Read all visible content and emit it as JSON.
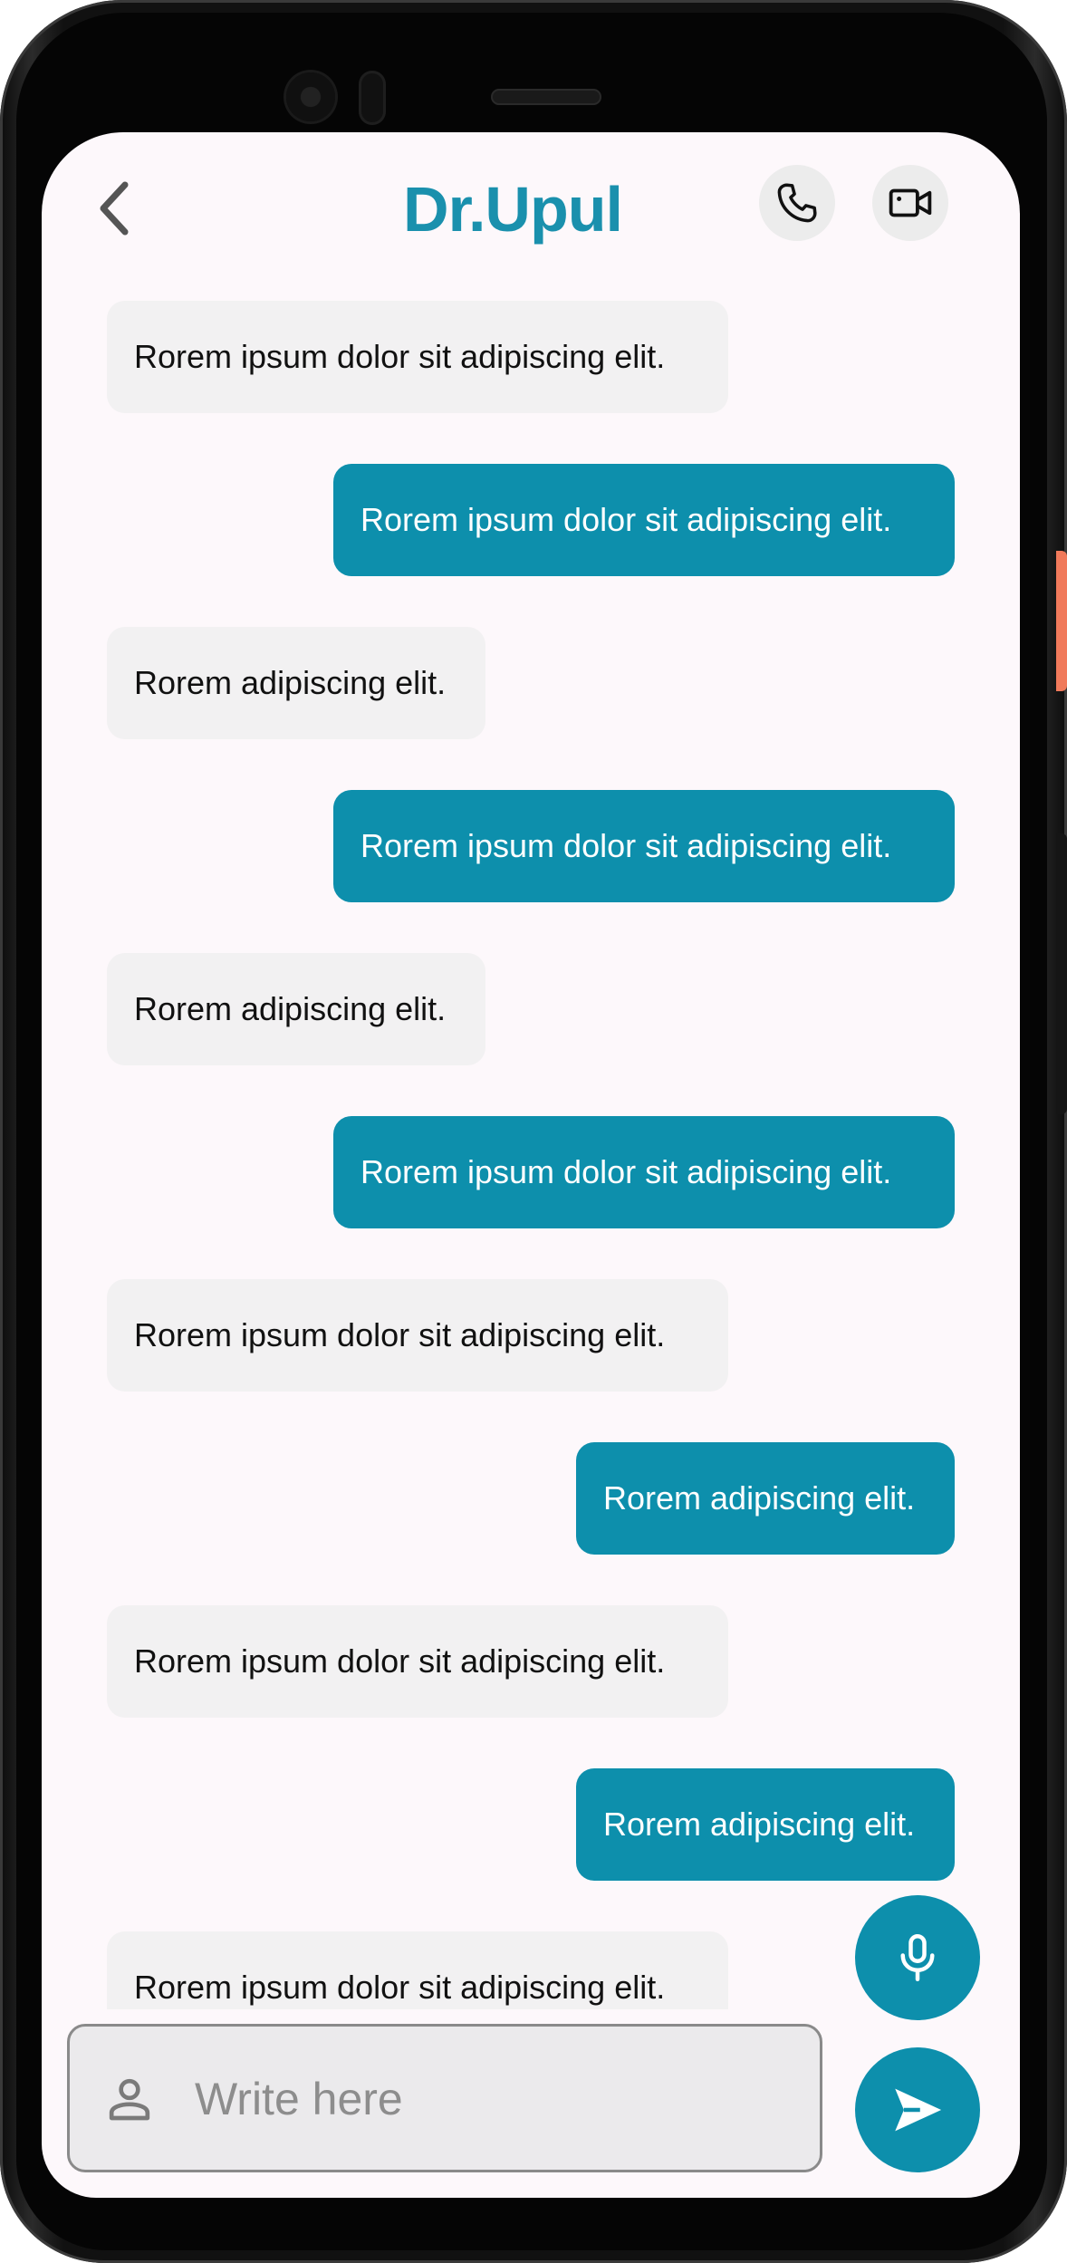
{
  "header": {
    "title": "Dr.Upul",
    "back_icon": "chevron-left-icon",
    "call_icon": "phone-icon",
    "video_icon": "video-camera-icon"
  },
  "messages": [
    {
      "from": "doctor",
      "text": "Rorem ipsum dolor sit  adipiscing elit."
    },
    {
      "from": "me",
      "text": "Rorem ipsum dolor sit  adipiscing elit."
    },
    {
      "from": "doctor",
      "text": "Rorem adipiscing elit."
    },
    {
      "from": "me",
      "text": "Rorem ipsum dolor sit  adipiscing elit."
    },
    {
      "from": "doctor",
      "text": "Rorem adipiscing elit."
    },
    {
      "from": "me",
      "text": "Rorem ipsum dolor sit  adipiscing elit."
    },
    {
      "from": "doctor",
      "text": "Rorem ipsum dolor sit  adipiscing elit."
    },
    {
      "from": "me",
      "text": "Rorem adipiscing elit."
    },
    {
      "from": "doctor",
      "text": "Rorem ipsum dolor sit  adipiscing elit."
    },
    {
      "from": "me",
      "text": "Rorem adipiscing elit."
    },
    {
      "from": "doctor",
      "text": "Rorem ipsum dolor sit  adipiscing elit."
    }
  ],
  "composer": {
    "placeholder": "Write here",
    "value": "",
    "user_icon": "user-icon",
    "mic_icon": "microphone-icon",
    "send_icon": "send-icon"
  },
  "colors": {
    "accent": "#0d8fac",
    "title": "#1a90ad",
    "received_bubble": "#f2f1f2",
    "screen_bg": "#fdf8fb"
  }
}
